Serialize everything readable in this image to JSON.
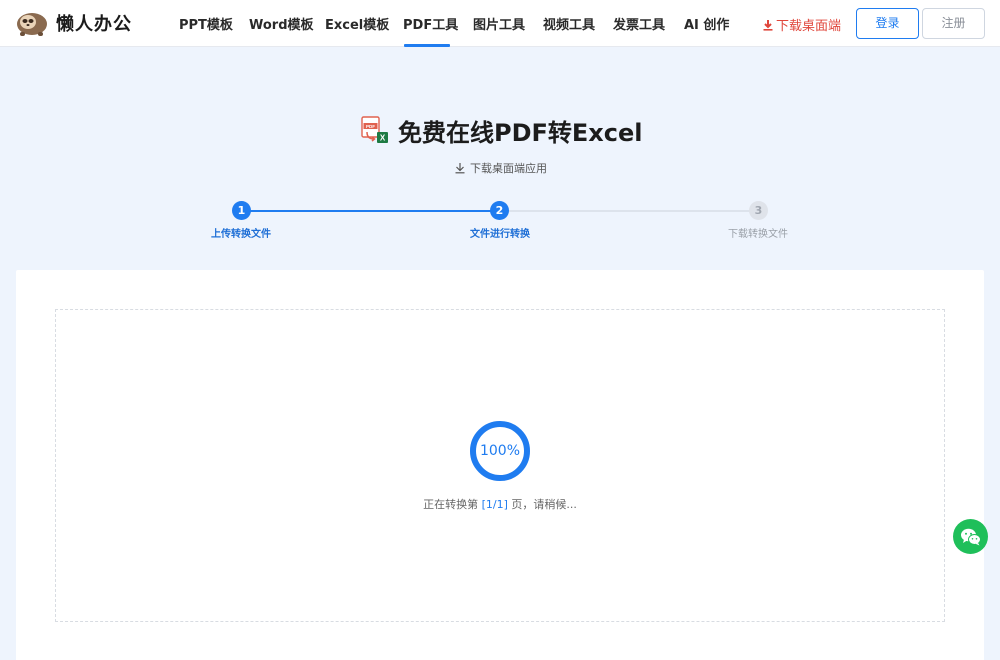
{
  "header": {
    "logo_text": "懒人办公",
    "nav": [
      {
        "label": "PPT模板"
      },
      {
        "label": "Word模板"
      },
      {
        "label": "Excel模板"
      },
      {
        "label": "PDF工具",
        "active": true
      },
      {
        "label": "图片工具"
      },
      {
        "label": "视频工具"
      },
      {
        "label": "发票工具"
      },
      {
        "label": "AI 创作"
      }
    ],
    "download_link": "下载桌面端",
    "login_label": "登录",
    "register_label": "注册"
  },
  "page": {
    "title": "免费在线PDF转Excel",
    "desktop_download": "下载桌面端应用"
  },
  "steps": [
    {
      "number": "1",
      "label": "上传转换文件",
      "state": "done"
    },
    {
      "number": "2",
      "label": "文件进行转换",
      "state": "done"
    },
    {
      "number": "3",
      "label": "下载转换文件",
      "state": "todo"
    }
  ],
  "progress": {
    "percent_label": "100%",
    "fraction": 1.0,
    "status_prefix": "正在转换第 ",
    "status_page": "[1/1]",
    "status_suffix": " 页，请稍候..."
  },
  "colors": {
    "accent": "#1f7cf0",
    "danger": "#e0463b",
    "wechat": "#1fbf5a",
    "page_bg": "#eef4fd"
  },
  "icons": {
    "logo": "sloth-logo-icon",
    "download": "download-icon",
    "title": "pdf-to-excel-icon",
    "fab": "wechat-icon"
  }
}
